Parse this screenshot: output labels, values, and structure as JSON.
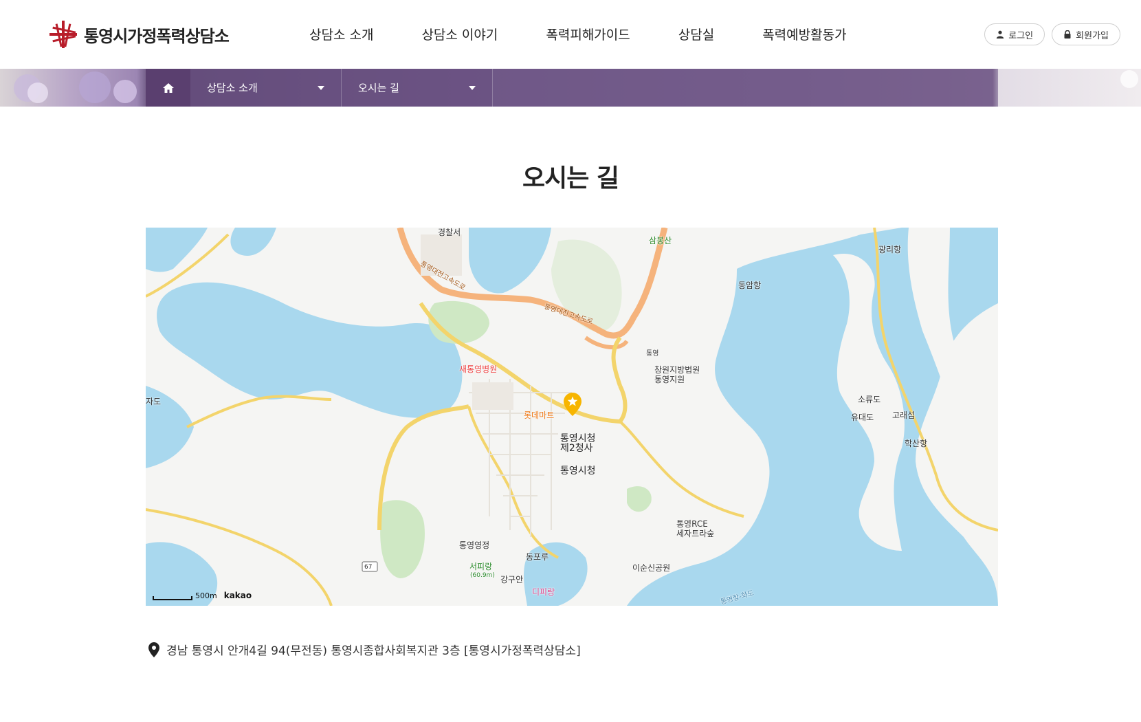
{
  "header": {
    "logo_text": "통영시가정폭력상담소",
    "nav": [
      "상담소 소개",
      "상담소 이야기",
      "폭력피해가이드",
      "상담실",
      "폭력예방활동가"
    ],
    "login_label": "로그인",
    "join_label": "회원가입"
  },
  "location": {
    "menu1": "상담소 소개",
    "menu2": "오시는 길"
  },
  "page_title": "오시는 길",
  "map": {
    "labels": {
      "police": "경찰서",
      "sambongsan": "삼봉산",
      "gwangriport": "광리항",
      "dongamport": "동암항",
      "ic": "통영",
      "court": "창원지방법원\n통영지원",
      "hospital": "새통영병원",
      "lottemart": "롯데마트",
      "cityhall2": "통영시청\n제2청사",
      "cityhall": "통영시청",
      "sorudo": "소류도",
      "yudo": "유대도",
      "goraeseom": "고래섬",
      "haksan": "학산항",
      "rce": "통영RCE\n세자트라숲",
      "tongyeong_camp": "통영영정",
      "dongporu": "동포루",
      "seopirang": "서피랑",
      "seopirang_h": "(60.9m)",
      "ganggu": "강구안",
      "dipirang": "디피랑",
      "isunsin": "이순신공원",
      "jado": "자도",
      "highway1": "통영대전고속도로",
      "highway2": "통영대전고속도로",
      "route": "67",
      "ferry": "통영항-화도"
    },
    "scale": "500m",
    "brand": "kakao"
  },
  "address": "경남 통영시 안개4길 94(무전동) 통영시종합사회복지관 3층 [통영시가정폭력상담소]",
  "colors": {
    "sea": "#a9d8ee",
    "land": "#f5f5f3",
    "road": "#f3d46b",
    "highway": "#f5b37c",
    "accent": "#5a3f6f"
  }
}
